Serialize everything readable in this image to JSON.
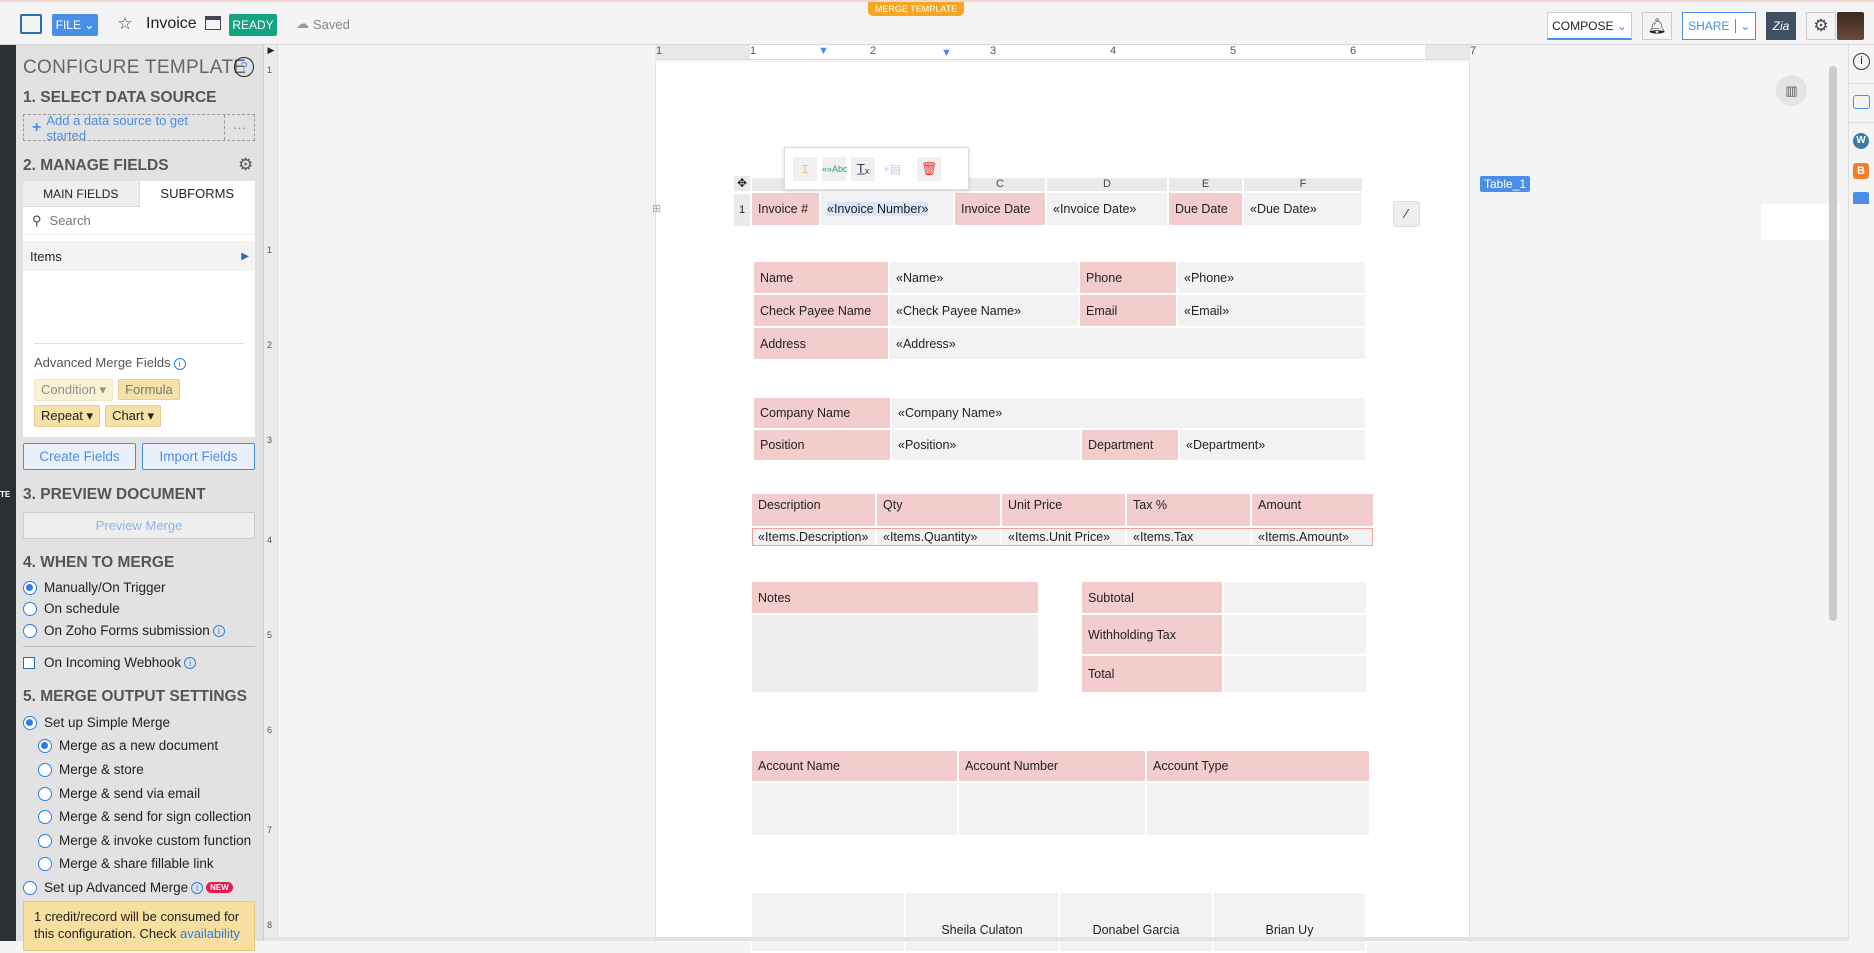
{
  "header": {
    "file_label": "FILE",
    "doc_title": "Invoice",
    "status_badge": "READY",
    "save_status": "Saved",
    "mode_tag": "MERGE TEMPLATE",
    "compose_label": "COMPOSE",
    "share_label": "SHARE",
    "zia_label": "Zia"
  },
  "sidebar_strip": {
    "label": "TE"
  },
  "panel": {
    "title": "CONFIGURE TEMPLATE",
    "help": "?",
    "s1": {
      "heading": "1. SELECT DATA SOURCE",
      "add_label": "Add a data source to get started",
      "more": "···"
    },
    "s2": {
      "heading": "2. MANAGE FIELDS",
      "tabs": [
        "MAIN FIELDS",
        "SUBFORMS"
      ],
      "search_placeholder": "Search",
      "items": [
        "Items"
      ],
      "advanced_label": "Advanced Merge Fields",
      "chips": [
        "Condition ▾",
        "Formula",
        "Repeat ▾",
        "Chart ▾"
      ],
      "create": "Create Fields",
      "import": "Import Fields"
    },
    "s3": {
      "heading": "3. PREVIEW DOCUMENT",
      "preview": "Preview Merge"
    },
    "s4": {
      "heading": "4. WHEN TO MERGE",
      "options": [
        "Manually/On Trigger",
        "On schedule",
        "On Zoho Forms submission"
      ],
      "selected": 0,
      "webhook": "On Incoming Webhook"
    },
    "s5": {
      "heading": "5. MERGE OUTPUT SETTINGS",
      "simple": "Set up Simple Merge",
      "sub_options": [
        "Merge as a new document",
        "Merge & store",
        "Merge & send via email",
        "Merge & send for sign collection",
        "Merge & invoke custom function",
        "Merge & share fillable link"
      ],
      "sub_selected": 0,
      "advanced": "Set up Advanced Merge",
      "new_badge": "NEW",
      "notice": "1 credit/record will be consumed for this configuration. Check ",
      "notice_link": "availability"
    }
  },
  "ruler": {
    "labels": [
      "1",
      "1",
      "2",
      "3",
      "4",
      "5",
      "6",
      "7"
    ]
  },
  "vruler": {
    "labels": [
      "1",
      "1",
      "2",
      "3",
      "4",
      "5",
      "6",
      "7",
      "8"
    ]
  },
  "doc": {
    "table_label": "Table_1",
    "col_letters": [
      "",
      "C",
      "D",
      "E",
      "F"
    ],
    "row_number": "1",
    "t1": [
      "Invoice #",
      "«Invoice Number»",
      "Invoice Date",
      "«Invoice Date»",
      "Due Date",
      "«Due Date»"
    ],
    "t2": [
      [
        "Name",
        "«Name»",
        "Phone",
        "«Phone»"
      ],
      [
        "Check Payee Name",
        "«Check Payee Name»",
        "Email",
        "«Email»"
      ],
      [
        "Address",
        "«Address»"
      ]
    ],
    "t3": [
      [
        "Company Name",
        "«Company Name»"
      ],
      [
        "Position",
        "«Position»",
        "Department",
        "«Department»"
      ]
    ],
    "items_head": [
      "Description",
      "Qty",
      "Unit Price",
      "Tax %",
      "Amount"
    ],
    "items_row": [
      "«Items.Description»",
      "«Items.Quantity»",
      "«Items.Unit Price»",
      "«Items.Tax",
      "«Items.Amount»"
    ],
    "notes": "Notes",
    "totals": [
      "Subtotal",
      "Withholding Tax",
      "Total"
    ],
    "account_head": [
      "Account Name",
      "Account Number",
      "Account Type"
    ],
    "signatures": [
      "",
      "Sheila Culaton",
      "Donabel Garcia",
      "Brian Uy"
    ]
  },
  "colors": {
    "accent": "#4a8fe7",
    "ready": "#13a57f",
    "merge_tag": "#f6a623",
    "field_header": "#f3cccc"
  }
}
